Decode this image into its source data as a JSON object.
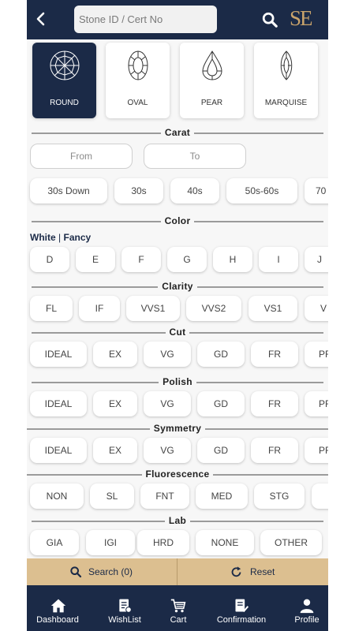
{
  "header": {
    "search_placeholder": "Stone ID / Cert No",
    "logo_text": "SE",
    "colors": {
      "header_bg": "#1b2a47",
      "gold": "#c9a36b"
    }
  },
  "shapes": [
    {
      "label": "ROUND",
      "selected": true,
      "icon": "round-diamond-icon"
    },
    {
      "label": "OVAL",
      "selected": false,
      "icon": "oval-diamond-icon"
    },
    {
      "label": "PEAR",
      "selected": false,
      "icon": "pear-diamond-icon"
    },
    {
      "label": "MARQUISE",
      "selected": false,
      "icon": "marquise-diamond-icon"
    }
  ],
  "carat": {
    "title": "Carat",
    "from_placeholder": "From",
    "to_placeholder": "To",
    "options": [
      "30s Down",
      "30s",
      "40s",
      "50s-60s",
      "70"
    ]
  },
  "color": {
    "title": "Color",
    "mode_white": "White",
    "mode_sep": "|",
    "mode_fancy": "Fancy",
    "options": [
      "D",
      "E",
      "F",
      "G",
      "H",
      "I",
      "J"
    ]
  },
  "clarity": {
    "title": "Clarity",
    "options": [
      "FL",
      "IF",
      "VVS1",
      "VVS2",
      "VS1",
      "V"
    ]
  },
  "cut": {
    "title": "Cut",
    "options": [
      "IDEAL",
      "EX",
      "VG",
      "GD",
      "FR",
      "PR"
    ]
  },
  "polish": {
    "title": "Polish",
    "options": [
      "IDEAL",
      "EX",
      "VG",
      "GD",
      "FR",
      "PR"
    ]
  },
  "symmetry": {
    "title": "Symmetry",
    "options": [
      "IDEAL",
      "EX",
      "VG",
      "GD",
      "FR",
      "PR"
    ]
  },
  "fluorescence": {
    "title": "Fluorescence",
    "options": [
      "NON",
      "SL",
      "FNT",
      "MED",
      "STG",
      ""
    ]
  },
  "lab": {
    "title": "Lab",
    "options": [
      "GIA",
      "IGI",
      "HRD",
      "NONE",
      "OTHER"
    ]
  },
  "actions": {
    "search_label": "Search (0)",
    "reset_label": "Reset",
    "bar_color": "#dcbf90"
  },
  "nav": [
    {
      "label": "Dashboard",
      "icon": "home-icon"
    },
    {
      "label": "WishList",
      "icon": "wishlist-icon"
    },
    {
      "label": "Cart",
      "icon": "cart-icon"
    },
    {
      "label": "Confirmation",
      "icon": "confirmation-icon"
    },
    {
      "label": "Profile",
      "icon": "profile-icon"
    }
  ]
}
